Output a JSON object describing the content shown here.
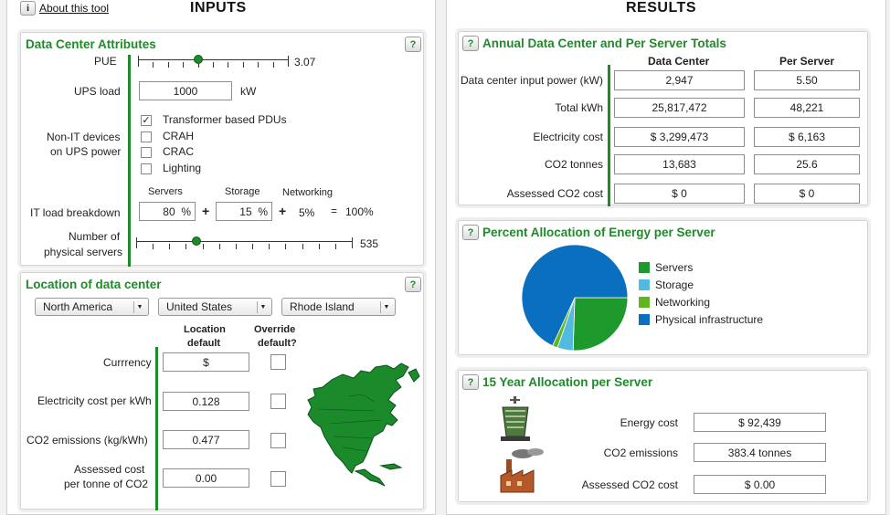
{
  "inputs_header": "INPUTS",
  "results_header": "RESULTS",
  "about_link": "About this tool",
  "dc_attributes": {
    "title": "Data Center Attributes",
    "help": "?",
    "pue_label": "PUE",
    "pue_value": "3.07",
    "pue_slider_fraction": 0.4,
    "ups_load_label": "UPS load",
    "ups_load_value": "1000",
    "ups_load_unit": "kW",
    "non_it_label_1": "Non-IT devices",
    "non_it_label_2": "on UPS power",
    "devices": [
      {
        "label": "Transformer based PDUs",
        "checked": true
      },
      {
        "label": "CRAH",
        "checked": false
      },
      {
        "label": "CRAC",
        "checked": false
      },
      {
        "label": "Lighting",
        "checked": false
      }
    ],
    "it_load_label": "IT load breakdown",
    "servers_label": "Servers",
    "storage_label": "Storage",
    "networking_label": "Networking",
    "servers_value": "80",
    "storage_value": "15",
    "networking_value": "5%",
    "percent_sign": "%",
    "plus": "+",
    "equals": "=",
    "total_value": "100%",
    "num_servers_label_1": "Number of",
    "num_servers_label_2": "physical servers",
    "num_servers_value": "535",
    "num_servers_slider_fraction": 0.28
  },
  "location": {
    "title": "Location of data center",
    "help": "?",
    "region": "North America",
    "country": "United States",
    "state": "Rhode Island",
    "col_default_1": "Location",
    "col_default_2": "default",
    "col_override_1": "Override",
    "col_override_2": "default?",
    "rows": [
      {
        "label": "Currrency",
        "value": "$"
      },
      {
        "label": "Electricity cost per kWh",
        "value": "0.128"
      },
      {
        "label": "CO2 emissions (kg/kWh)",
        "value": "0.477"
      },
      {
        "label_1": "Assessed cost",
        "label_2": "per tonne of CO2",
        "value": "0.00"
      }
    ]
  },
  "annual": {
    "title": "Annual Data Center and Per Server Totals",
    "help": "?",
    "col_dc": "Data Center",
    "col_ps": "Per Server",
    "rows": [
      {
        "label": "Data center input power (kW)",
        "dc": "2,947",
        "ps": "5.50"
      },
      {
        "label": "Total kWh",
        "dc": "25,817,472",
        "ps": "48,221"
      },
      {
        "label": "Electricity cost",
        "dc": "$ 3,299,473",
        "ps": "$ 6,163"
      },
      {
        "label": "CO2 tonnes",
        "dc": "13,683",
        "ps": "25.6"
      },
      {
        "label": "Assessed CO2 cost",
        "dc": "$ 0",
        "ps": "$ 0"
      }
    ]
  },
  "allocation": {
    "title": "Percent Allocation of Energy per Server",
    "help": "?",
    "legend": [
      {
        "label": "Servers",
        "color": "#1e9a2c",
        "value": 25.5
      },
      {
        "label": "Storage",
        "color": "#52b9e0",
        "value": 4.8
      },
      {
        "label": "Networking",
        "color": "#5fb61e",
        "value": 1.6
      },
      {
        "label": "Physical infrastructure",
        "color": "#0a6fbf",
        "value": 68.1
      }
    ]
  },
  "fifteen": {
    "title": "15 Year Allocation per Server",
    "help": "?",
    "rows": [
      {
        "label": "Energy cost",
        "value": "$ 92,439"
      },
      {
        "label": "CO2 emissions",
        "value": "383.4 tonnes"
      },
      {
        "label": "Assessed CO2 cost",
        "value": "$ 0.00"
      }
    ]
  }
}
